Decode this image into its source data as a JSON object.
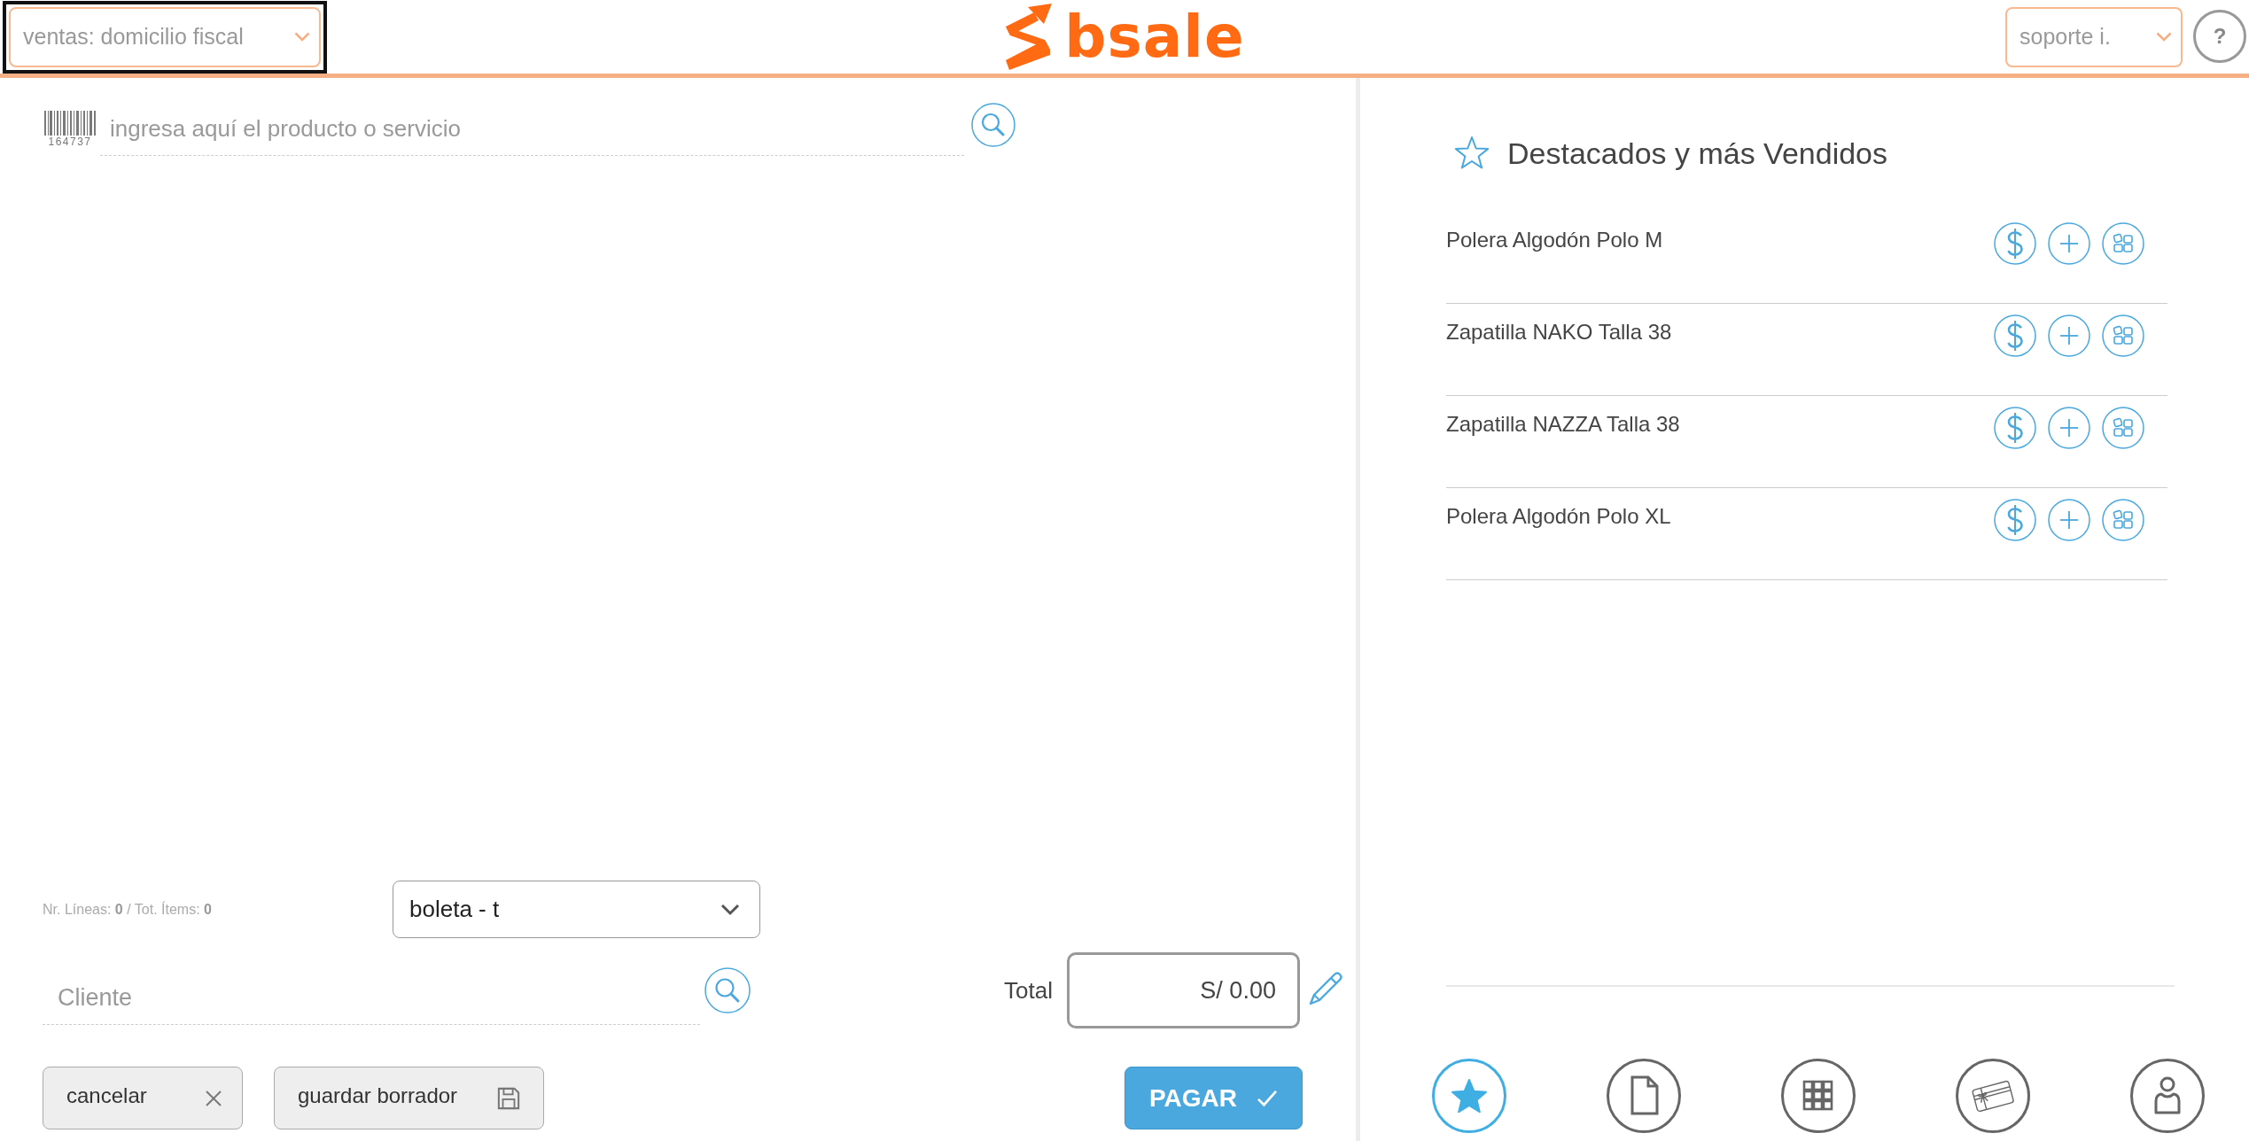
{
  "header": {
    "location_select": {
      "value": "ventas: domicilio fiscal",
      "focused": true
    },
    "logo": {
      "text": "bsale"
    },
    "user_select": {
      "value": "soporte i."
    },
    "help_button": {
      "label": "?"
    }
  },
  "sale": {
    "product_search": {
      "barcode_number": "164737",
      "placeholder": "ingresa aquí el producto o servicio"
    },
    "summary": "Nr. Líneas: **0** / Tot. Ítems: **0**",
    "document_type": {
      "value": "boleta - t"
    },
    "client_search": {
      "placeholder": "Cliente"
    },
    "total": {
      "label": "Total",
      "value": "S/ 0.00"
    },
    "actions": [
      {
        "kind": "cancel",
        "label": "cancelar"
      },
      {
        "kind": "save",
        "label": "guardar borrador"
      }
    ],
    "pay_button": {
      "label": "PAGAR"
    }
  },
  "featured": {
    "title": "Destacados y más Vendidos",
    "products": [
      {
        "name": "Polera Algodón Polo M"
      },
      {
        "name": "Zapatilla NAKO Talla 38"
      },
      {
        "name": "Zapatilla NAZZA Talla 38"
      },
      {
        "name": "Polera Algodón Polo XL"
      }
    ]
  },
  "bottom_nav": [
    {
      "kind": "featured",
      "selected": true
    },
    {
      "kind": "document",
      "selected": false
    },
    {
      "kind": "catalog",
      "selected": false
    },
    {
      "kind": "gift_card",
      "selected": false
    },
    {
      "kind": "client",
      "selected": false
    }
  ]
}
